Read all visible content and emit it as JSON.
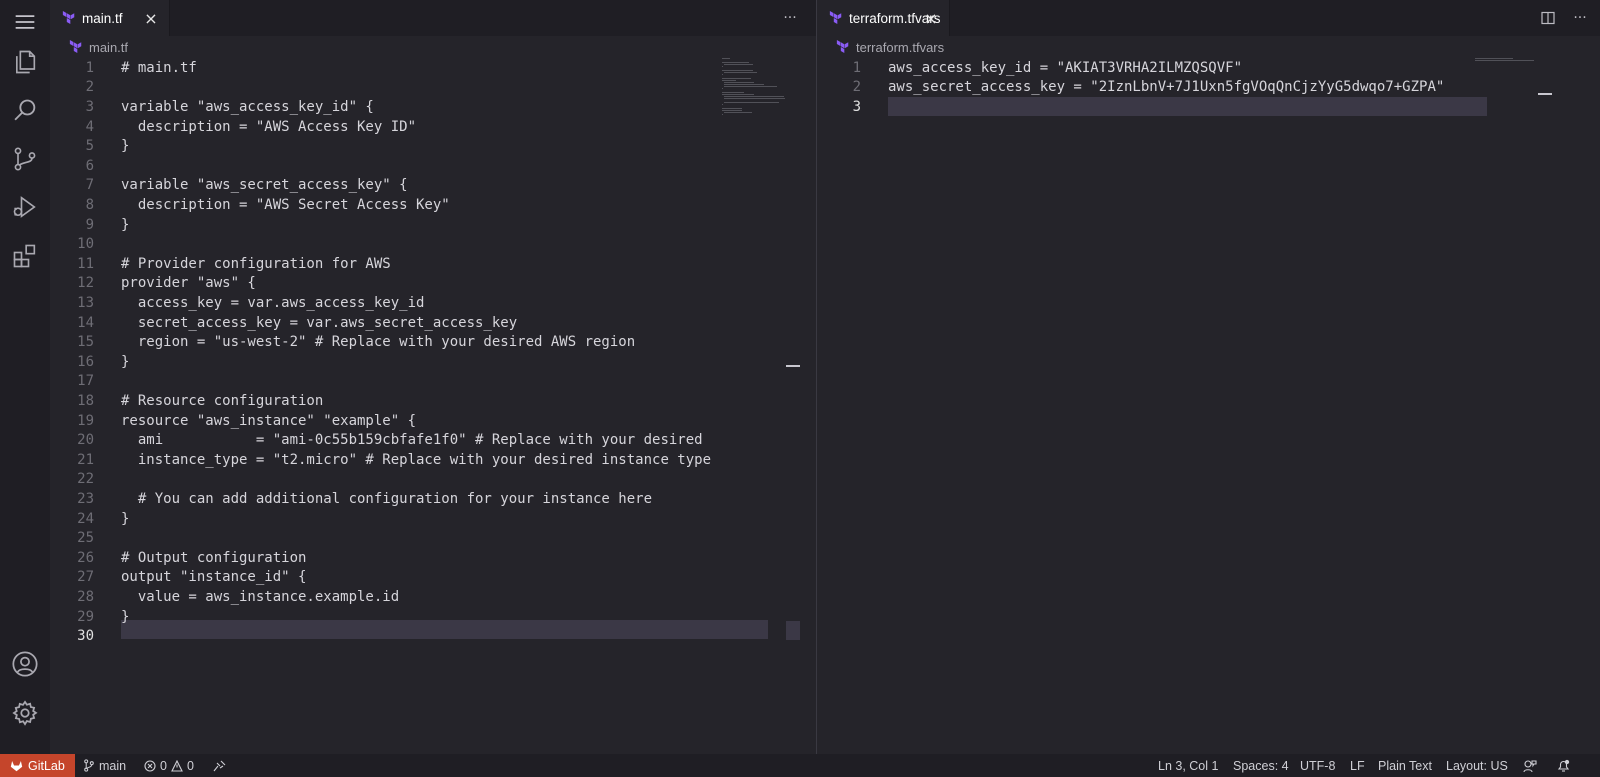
{
  "colors": {
    "terraform_purple": "#8b5cf6",
    "remote_badge": "#c5452b",
    "current_line": "#3b3846"
  },
  "activity_bar": {
    "items": [
      "menu-icon",
      "explorer-icon",
      "search-icon",
      "source-control-icon",
      "run-debug-icon",
      "extensions-icon"
    ],
    "bottom": [
      "account-icon",
      "settings-gear-icon"
    ]
  },
  "left_editor": {
    "tab": {
      "label": "main.tf",
      "close": "×"
    },
    "more_actions": "···",
    "breadcrumb": "main.tf",
    "current_line": 30,
    "lines": [
      "# main.tf",
      "",
      "variable \"aws_access_key_id\" {",
      "  description = \"AWS Access Key ID\"",
      "}",
      "",
      "variable \"aws_secret_access_key\" {",
      "  description = \"AWS Secret Access Key\"",
      "}",
      "",
      "# Provider configuration for AWS",
      "provider \"aws\" {",
      "  access_key = var.aws_access_key_id",
      "  secret_access_key = var.aws_secret_access_key",
      "  region = \"us-west-2\" # Replace with your desired AWS region",
      "}",
      "",
      "# Resource configuration",
      "resource \"aws_instance\" \"example\" {",
      "  ami           = \"ami-0c55b159cbfafe1f0\" # Replace with your desired",
      "  instance_type = \"t2.micro\" # Replace with your desired instance type",
      "",
      "  # You can add additional configuration for your instance here",
      "}",
      "",
      "# Output configuration",
      "output \"instance_id\" {",
      "  value = aws_instance.example.id",
      "}",
      ""
    ]
  },
  "right_editor": {
    "tab": {
      "label": "terraform.tfvars",
      "close": "×"
    },
    "breadcrumb": "terraform.tfvars",
    "current_line": 3,
    "lines": [
      "aws_access_key_id = \"AKIAT3VRHA2ILMZQSQVF\"",
      "aws_secret_access_key = \"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\"",
      ""
    ]
  },
  "status_bar": {
    "remote": "GitLab",
    "branch": "main",
    "errors": "0",
    "warnings": "0",
    "position": "Ln 3, Col 1",
    "spaces": "Spaces: 4",
    "encoding": "UTF-8",
    "eol": "LF",
    "language": "Plain Text",
    "layout": "Layout: US"
  }
}
